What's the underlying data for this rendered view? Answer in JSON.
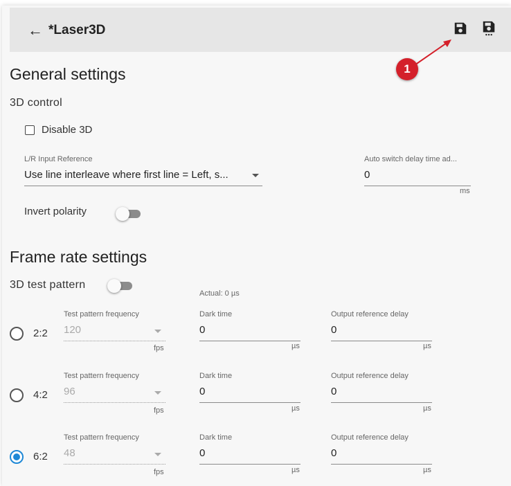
{
  "header": {
    "back_icon": "arrow-left-icon",
    "title": "*Laser3D",
    "save_icon": "floppy-disk-icon",
    "save_as_icon": "floppy-disk-more-icon"
  },
  "annotation": {
    "badge": "1",
    "color": "#d4202a"
  },
  "general": {
    "heading": "General settings",
    "control_heading": "3D control",
    "disable_3d": {
      "label": "Disable 3D",
      "checked": false
    },
    "lr_input": {
      "label": "L/R Input Reference",
      "value": "Use line interleave where first line = Left, s..."
    },
    "auto_switch": {
      "label": "Auto switch delay time ad...",
      "value": "0",
      "unit": "ms"
    },
    "invert_polarity": {
      "label": "Invert polarity",
      "on": false
    }
  },
  "frame_rate": {
    "heading": "Frame rate settings",
    "test_pattern": {
      "label": "3D test pattern",
      "on": false
    },
    "actual": "Actual: 0 µs",
    "rows": [
      {
        "ratio": "2:2",
        "selected": false,
        "freq_label": "Test pattern frequency",
        "freq_value": "120",
        "freq_unit": "fps",
        "dark_label": "Dark time",
        "dark_value": "0",
        "dark_unit": "µs",
        "delay_label": "Output reference delay",
        "delay_value": "0",
        "delay_unit": "µs"
      },
      {
        "ratio": "4:2",
        "selected": false,
        "freq_label": "Test pattern frequency",
        "freq_value": "96",
        "freq_unit": "fps",
        "dark_label": "Dark time",
        "dark_value": "0",
        "dark_unit": "µs",
        "delay_label": "Output reference delay",
        "delay_value": "0",
        "delay_unit": "µs"
      },
      {
        "ratio": "6:2",
        "selected": true,
        "freq_label": "Test pattern frequency",
        "freq_value": "48",
        "freq_unit": "fps",
        "dark_label": "Dark time",
        "dark_value": "0",
        "dark_unit": "µs",
        "delay_label": "Output reference delay",
        "delay_value": "0",
        "delay_unit": "µs"
      }
    ]
  },
  "colors": {
    "accent": "#1e88d6",
    "header_bg": "#e6e6e6"
  }
}
